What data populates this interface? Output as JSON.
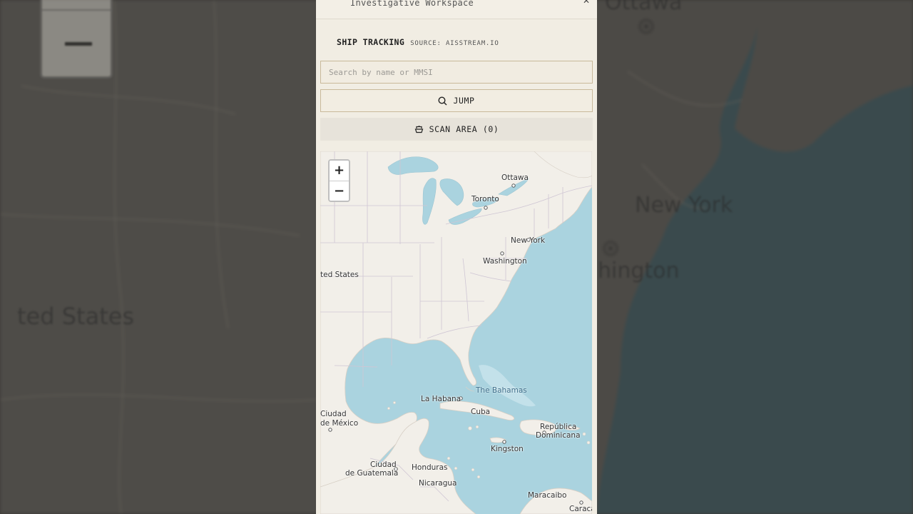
{
  "app": {
    "title": "Investigative Workspace",
    "menu_icon": "hamburger-icon",
    "corner_icon": "close-icon"
  },
  "ship_tracking": {
    "title": "SHIP TRACKING",
    "source": "SOURCE: AISSTREAM.IO",
    "search_placeholder": "Search by name or MMSI",
    "search_value": "",
    "jump_label": "JUMP",
    "jump_icon": "search-icon",
    "scan_label": "SCAN AREA (0)",
    "scan_icon": "ship-icon"
  },
  "map": {
    "zoom_in": "+",
    "zoom_out": "−",
    "labels": {
      "ottawa": "Ottawa",
      "toronto": "Toronto",
      "new_york": "New York",
      "washington": "Washington",
      "united_states": "ted States",
      "la_habana": "La Habana",
      "the_bahamas": "The Bahamas",
      "cuba": "Cuba",
      "ciudad_mexico_1": "Ciudad",
      "ciudad_mexico_2": "de México",
      "republica_1": "República",
      "republica_2": "Dominicana",
      "kingston": "Kingston",
      "ciudad_guatemala_1": "Ciudad",
      "ciudad_guatemala_2": "de Guatemala",
      "honduras": "Honduras",
      "nicaragua": "Nicaragua",
      "maracaibo": "Maracaibo",
      "caracas": "Caraca"
    }
  },
  "backdrop": {
    "ottawa": "Ottawa",
    "new_york": "New York",
    "washington": "hington",
    "united_states": "ted States"
  },
  "colors": {
    "panel": "#f1ede3",
    "water": "#aad3df",
    "land": "#f2efe9",
    "accent_border": "#c9b99a"
  }
}
